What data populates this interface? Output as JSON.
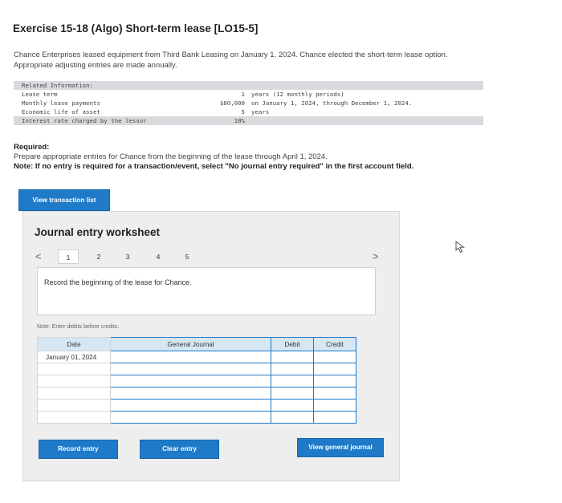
{
  "header": {
    "title": "Exercise 15-18 (Algo) Short-term lease [LO15-5]",
    "intro_line1": "Chance Enterprises leased equipment from Third Bank Leasing on January 1, 2024. Chance elected the short-term lease option.",
    "intro_line2": "Appropriate adjusting entries are made annually."
  },
  "related_info": {
    "heading": "Related Information:",
    "rows": [
      {
        "label": "Lease term",
        "value": "1",
        "detail": "years (12 monthly periods)"
      },
      {
        "label": "Monthly lease payments",
        "value": "$80,000",
        "detail": "on January 1, 2024, through December 1, 2024."
      },
      {
        "label": "Economic life of asset",
        "value": "5",
        "detail": "years"
      },
      {
        "label": "Interest rate charged by the lessor",
        "value": "10%",
        "detail": ""
      }
    ]
  },
  "required": {
    "heading": "Required:",
    "text": "Prepare appropriate entries for Chance from the beginning of the lease through April 1, 2024.",
    "note": "Note: If no entry is required for a transaction/event, select \"No journal entry required\" in the first account field."
  },
  "buttons": {
    "view_transactions": "View transaction list",
    "record_entry": "Record entry",
    "clear_entry": "Clear entry",
    "view_general_journal": "View general journal"
  },
  "worksheet": {
    "title": "Journal entry worksheet",
    "prev": "<",
    "next": ">",
    "pages": [
      "1",
      "2",
      "3",
      "4",
      "5"
    ],
    "active_page": "1",
    "instruction": "Record the beginning of the lease for Chance.",
    "note": "Note: Enter debits before credits."
  },
  "journal_table": {
    "headers": {
      "date": "Date",
      "account": "General Journal",
      "debit": "Debit",
      "credit": "Credit"
    },
    "rows": [
      {
        "date": "January 01, 2024",
        "account": "",
        "debit": "",
        "credit": ""
      },
      {
        "date": "",
        "account": "",
        "debit": "",
        "credit": ""
      },
      {
        "date": "",
        "account": "",
        "debit": "",
        "credit": ""
      },
      {
        "date": "",
        "account": "",
        "debit": "",
        "credit": ""
      },
      {
        "date": "",
        "account": "",
        "debit": "",
        "credit": ""
      },
      {
        "date": "",
        "account": "",
        "debit": "",
        "credit": ""
      }
    ]
  },
  "colors": {
    "accent": "#1f7ac8",
    "header_fill": "#d5e6f4",
    "worksheet_bg": "#eeeeee"
  }
}
